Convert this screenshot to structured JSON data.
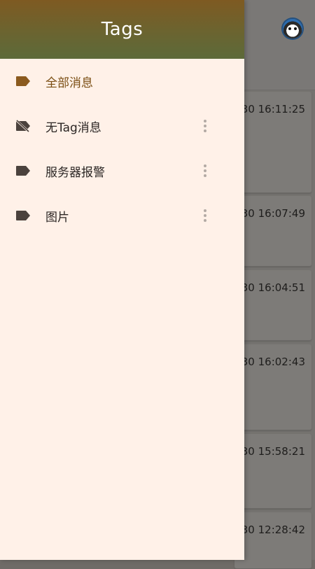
{
  "drawer": {
    "title": "Tags",
    "items": [
      {
        "label": "全部消息",
        "icon": "tag-icon",
        "active": true,
        "has_menu": false
      },
      {
        "label": "无Tag消息",
        "icon": "tag-off-icon",
        "active": false,
        "has_menu": true
      },
      {
        "label": "服务器报警",
        "icon": "tag-icon",
        "active": false,
        "has_menu": true
      },
      {
        "label": "图片",
        "icon": "tag-icon",
        "active": false,
        "has_menu": true
      }
    ]
  },
  "background": {
    "timestamps": [
      "-30 16:11:25",
      "30 16:07:49",
      "30 16:04:51",
      "30 16:02:43",
      "30 15:58:21",
      "30 12:28:42"
    ]
  },
  "colors": {
    "active_tag": "#8b5a1e",
    "inactive_tag": "#4b423d",
    "drawer_bg": "#fff1e8",
    "scrim": "#757370"
  }
}
